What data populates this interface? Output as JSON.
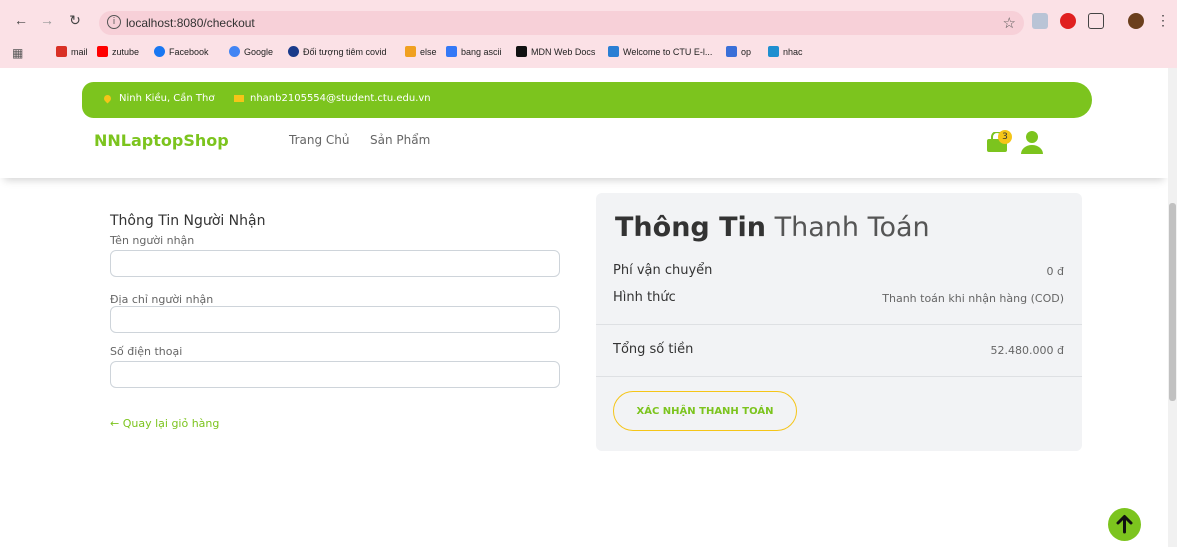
{
  "browser": {
    "url": "localhost:8080/checkout",
    "bookmarks": [
      {
        "label": "mail",
        "color": "#d93025"
      },
      {
        "label": "zutube",
        "color": "#ff0000"
      },
      {
        "label": "Facebook",
        "color": "#1877f2"
      },
      {
        "label": "Google",
        "color": "#4285f4"
      },
      {
        "label": "Đối tượng tiêm covid",
        "color": "#1a3a8a"
      },
      {
        "label": "else",
        "color": "#f0a020"
      },
      {
        "label": "bang ascii",
        "color": "#3478f6"
      },
      {
        "label": "MDN Web Docs",
        "color": "#111111"
      },
      {
        "label": "Welcome to CTU E-l...",
        "color": "#2a7fd4"
      },
      {
        "label": "op",
        "color": "#3a6fd8"
      },
      {
        "label": "nhac",
        "color": "#1f8fd0"
      }
    ]
  },
  "topbar": {
    "location": "Ninh Kiều, Cần Thơ",
    "email": "nhanb2105554@student.ctu.edu.vn"
  },
  "header": {
    "logo": "NNLaptopShop",
    "nav": [
      "Trang Chủ",
      "Sản Phẩm"
    ],
    "cart_count": "3"
  },
  "form": {
    "title": "Thông Tin Người Nhận",
    "fields": [
      {
        "label": "Tên người nhận",
        "value": ""
      },
      {
        "label": "Địa chỉ người nhận",
        "value": ""
      },
      {
        "label": "Số điện thoại",
        "value": ""
      }
    ],
    "back_link": "Quay lại giỏ hàng"
  },
  "payment": {
    "title_bold": "Thông Tin",
    "title_light": "Thanh Toán",
    "rows": [
      {
        "label": "Phí vận chuyển",
        "value": "0 đ"
      },
      {
        "label": "Hình thức",
        "value": "Thanh toán khi nhận hàng (COD)"
      }
    ],
    "total_label": "Tổng số tiền",
    "total_value": "52.480.000 đ",
    "confirm_button": "XÁC NHẬN THANH TOÁN"
  },
  "colors": {
    "brand": "#7cc41e",
    "accent": "#f5c518"
  }
}
